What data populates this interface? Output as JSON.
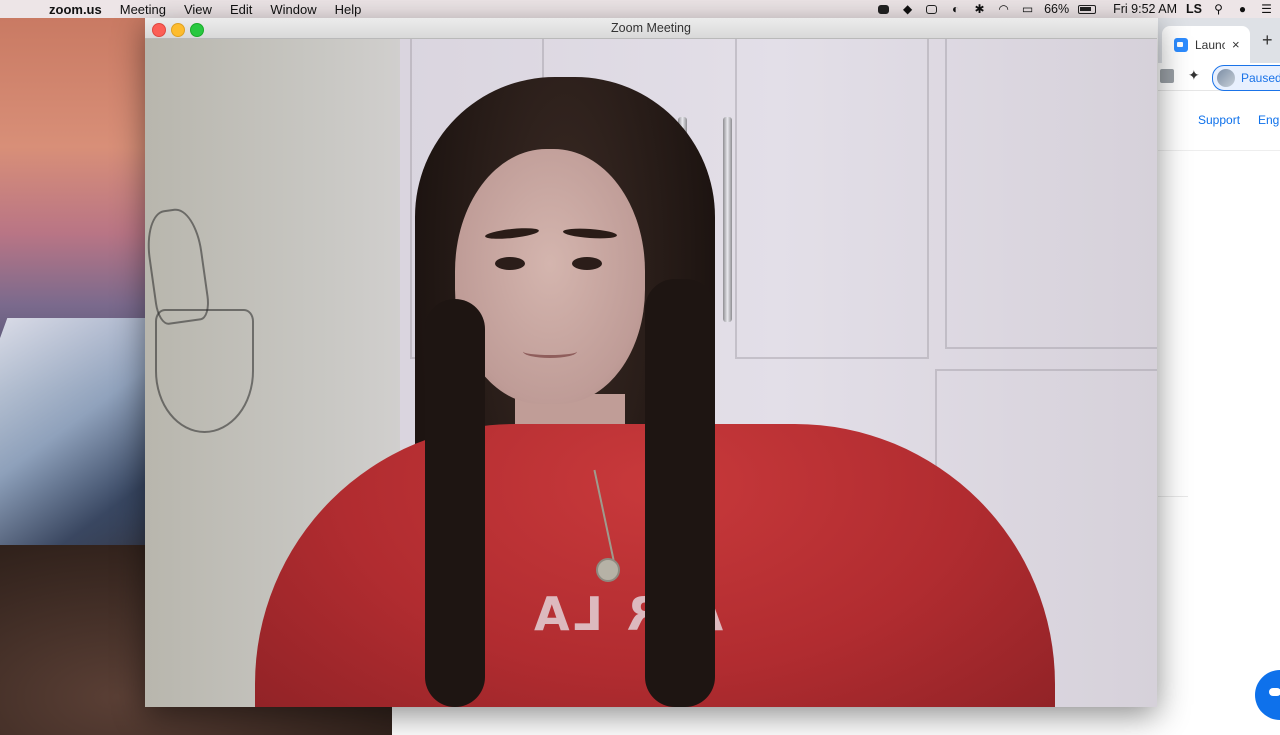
{
  "menubar": {
    "apple_icon": "apple-icon",
    "app_name": "zoom.us",
    "menus": [
      "Meeting",
      "View",
      "Edit",
      "Window",
      "Help"
    ],
    "status": {
      "icons": [
        "zoom-camera-icon",
        "dropbox-icon",
        "notes-icon",
        "clock-icon",
        "bluetooth-icon",
        "wifi-icon",
        "airplay-icon"
      ],
      "battery": "66%",
      "time": "Fri 9:52 AM",
      "user": "LS",
      "search_icon": "search-icon",
      "siri_icon": "siri-icon",
      "notifications_icon": "notification-center-icon"
    }
  },
  "zoom_window": {
    "title": "Zoom Meeting"
  },
  "browser": {
    "tab_title": "Launc",
    "close": "×",
    "new_tab": "+",
    "profile_status": "Paused",
    "nav_links": [
      "Support",
      "Engl"
    ]
  }
}
